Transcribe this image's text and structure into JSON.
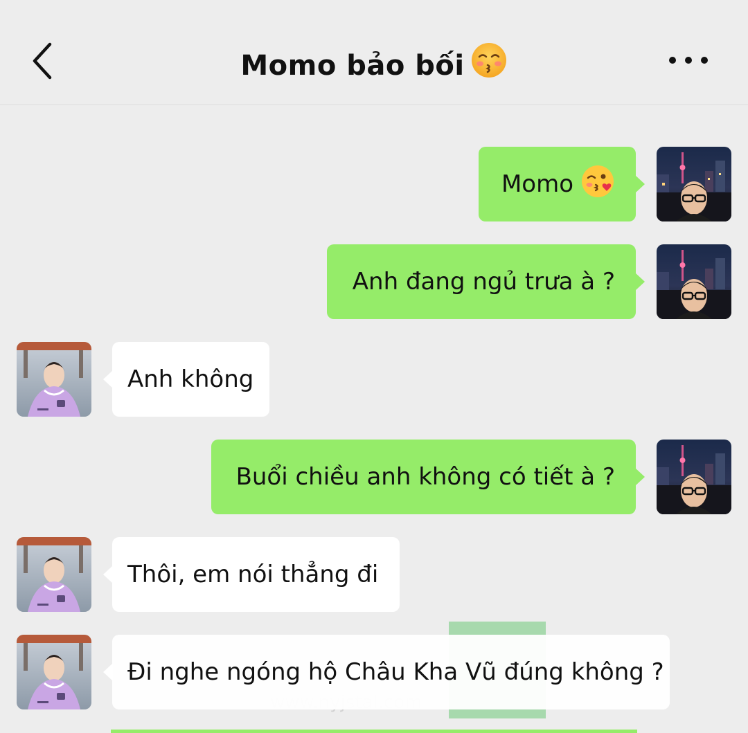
{
  "header": {
    "title": "Momo bảo bối",
    "back_icon": "chevron-left-icon",
    "more_icon": "more-dots-icon",
    "title_emoji": "kissing-smiling-eyes-emoji"
  },
  "messages": [
    {
      "side": "out",
      "text": "Momo",
      "emoji": "kissing-heart-emoji"
    },
    {
      "side": "out",
      "text": "Anh đang ngủ trưa à ?"
    },
    {
      "side": "in",
      "text": "Anh không"
    },
    {
      "side": "out",
      "text": "Buổi chiều anh không có tiết à ?"
    },
    {
      "side": "in",
      "text": "Thôi, em nói thẳng đi"
    },
    {
      "side": "in",
      "text": "Đi nghe ngóng hộ Châu Kha Vũ đúng không ?"
    }
  ],
  "watermark": "www.nyjstal.com",
  "colors": {
    "background": "#ededed",
    "outgoing_bubble": "#95ec69",
    "incoming_bubble": "#ffffff",
    "text": "#111111"
  }
}
